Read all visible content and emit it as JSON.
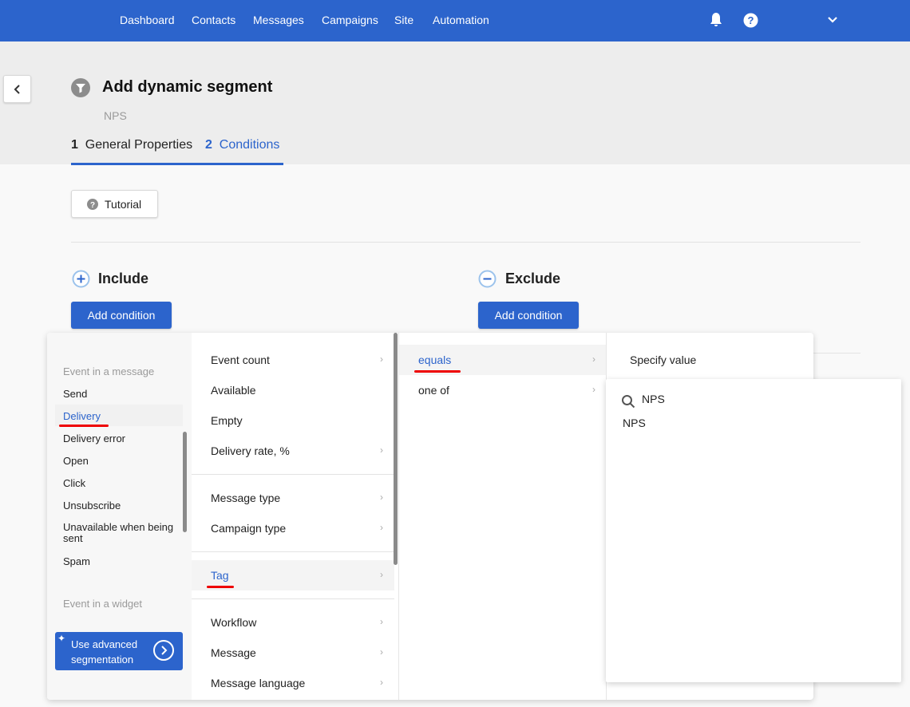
{
  "nav": {
    "items": [
      "Dashboard",
      "Contacts",
      "Messages",
      "Campaigns",
      "Site",
      "Automation"
    ],
    "icons": [
      "bell-icon",
      "help-icon",
      "chevron-down-icon"
    ]
  },
  "header": {
    "title": "Add dynamic segment",
    "subtitle": "NPS",
    "steps": [
      {
        "num": "1",
        "label": "General Properties"
      },
      {
        "num": "2",
        "label": "Conditions"
      }
    ]
  },
  "tutorial_label": "Tutorial",
  "include": {
    "title": "Include",
    "button": "Add condition"
  },
  "exclude": {
    "title": "Exclude",
    "button": "Add condition"
  },
  "menu": {
    "col1": {
      "group1": "Event in a message",
      "items": [
        "Send",
        "Delivery",
        "Delivery error",
        "Open",
        "Click",
        "Unsubscribe",
        "Unavailable when being sent",
        "Spam"
      ],
      "group2": "Event in a widget",
      "advanced": "Use advanced segmentation",
      "selected": "Delivery"
    },
    "col2": {
      "items": [
        "Event count",
        "Available",
        "Empty",
        "Delivery rate, %",
        "Message type",
        "Campaign type",
        "Tag",
        "Workflow",
        "Message",
        "Message language"
      ],
      "selected": "Tag"
    },
    "col3": {
      "items": [
        "equals",
        "one of"
      ],
      "selected": "equals"
    },
    "col4": {
      "label": "Specify value"
    },
    "search": {
      "value": "NPS",
      "results": [
        "NPS"
      ]
    }
  },
  "colors": {
    "brand": "#2c64cc",
    "highlight": "#e00000"
  }
}
